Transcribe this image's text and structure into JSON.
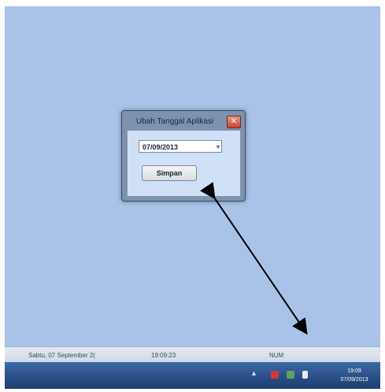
{
  "dialog": {
    "title": "Ubah Tanggal Aplikasi",
    "close_glyph": "✕",
    "date_value": "07/09/2013",
    "dropdown_glyph": "▾",
    "save_label": "Simpan"
  },
  "statusbar": {
    "date_text": "Sabtu, 07 September 2(",
    "time_text": "19:09:23",
    "num_text": "NUM"
  },
  "taskbar": {
    "show_hidden_glyph": "▴",
    "icons": [
      "flag-icon",
      "network-icon",
      "volume-icon"
    ],
    "clock_time": "19:09",
    "clock_date": "07/09/2013"
  },
  "colors": {
    "desktop": "#a9c3e8",
    "taskbar": "#284d85",
    "arrow": "#000000"
  }
}
